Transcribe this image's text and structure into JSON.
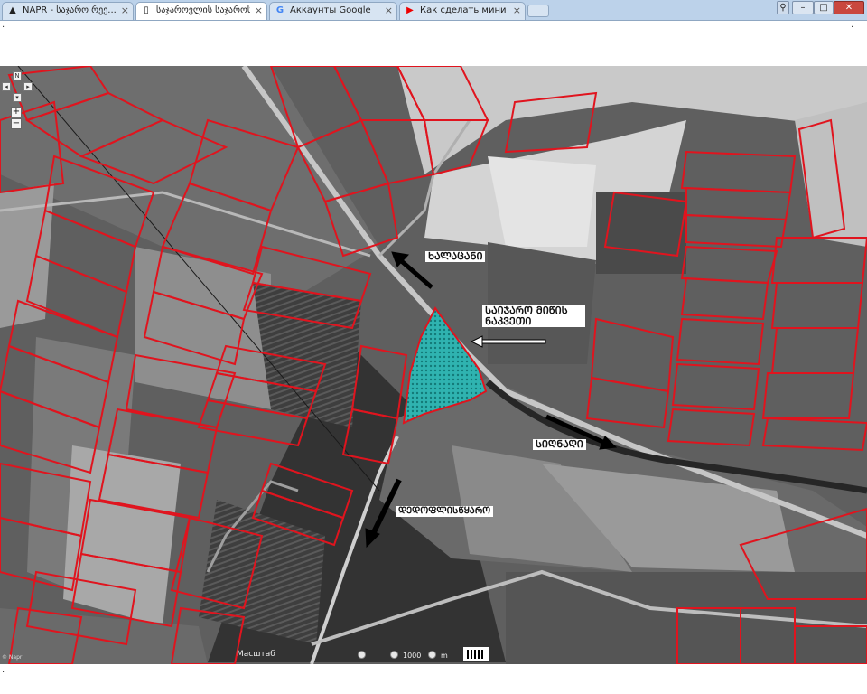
{
  "browser": {
    "tabs": [
      {
        "title": "NAPR - საჯარო რეე...",
        "icon": "napr-favicon",
        "active": false
      },
      {
        "title": "საჯაროვლის საჯაროს",
        "icon": "document-icon",
        "active": true
      },
      {
        "title": "Аккаунты Google",
        "icon": "google-icon",
        "active": false
      },
      {
        "title": "Как сделать мини буров...",
        "icon": "youtube-icon",
        "active": false
      }
    ],
    "window_controls": {
      "minimize": "–",
      "maximize": "□",
      "close": "✕"
    }
  },
  "page": {
    "top_marker": ".",
    "bottom_marker": "."
  },
  "map": {
    "navigation": {
      "north": "N",
      "zoom_in": "+",
      "zoom_out": "−"
    },
    "labels": {
      "north_direction": "ᲮᲐᲚᲐᲪᲐᲜᲘ",
      "plot": "ᲡᲐᲘᲯᲐᲠᲝ ᲛᲘᲬᲘᲡ ᲜᲐᲙᲕᲔᲗᲘ",
      "east_direction": "ᲡᲘᲦᲜᲐᲦᲘ",
      "south_direction": "ᲓᲔᲓᲝᲤᲚᲘᲡᲬᲧᲐᲠᲝ"
    },
    "scale": {
      "label": "Масштаб",
      "value": "1000",
      "unit": "m"
    },
    "copyright": "© Napr"
  },
  "colors": {
    "parcel_outline": "#e0141e",
    "plot_fill": "#2fb3b0",
    "label_background": "#ffffff",
    "arrow": "#000000"
  }
}
